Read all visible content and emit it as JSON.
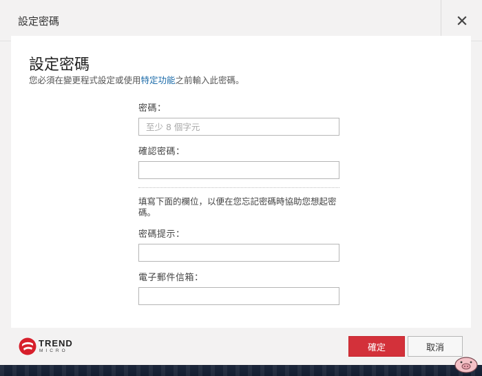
{
  "window": {
    "title": "設定密碼",
    "close_icon": "close-icon"
  },
  "main": {
    "heading": "設定密碼",
    "subtitle_pre": "您必須在變更程式設定或使用",
    "subtitle_link": "特定功能",
    "subtitle_post": "之前輸入此密碼。"
  },
  "form": {
    "password_label": "密碼：",
    "password_placeholder": "至少 8 個字元",
    "confirm_label": "確認密碼：",
    "confirm_value": "",
    "info_text": "填寫下面的欄位，以便在您忘記密碼時協助您想起密碼。",
    "hint_label": "密碼提示：",
    "hint_value": "",
    "email_label": "電子郵件信箱：",
    "email_value": ""
  },
  "footer": {
    "brand_word": "TREND",
    "brand_sub": "MICRO",
    "ok_label": "確定",
    "cancel_label": "取消"
  },
  "colors": {
    "accent": "#d3313a",
    "link": "#1a6aa8",
    "dialog_bg": "#f3f2f2"
  }
}
